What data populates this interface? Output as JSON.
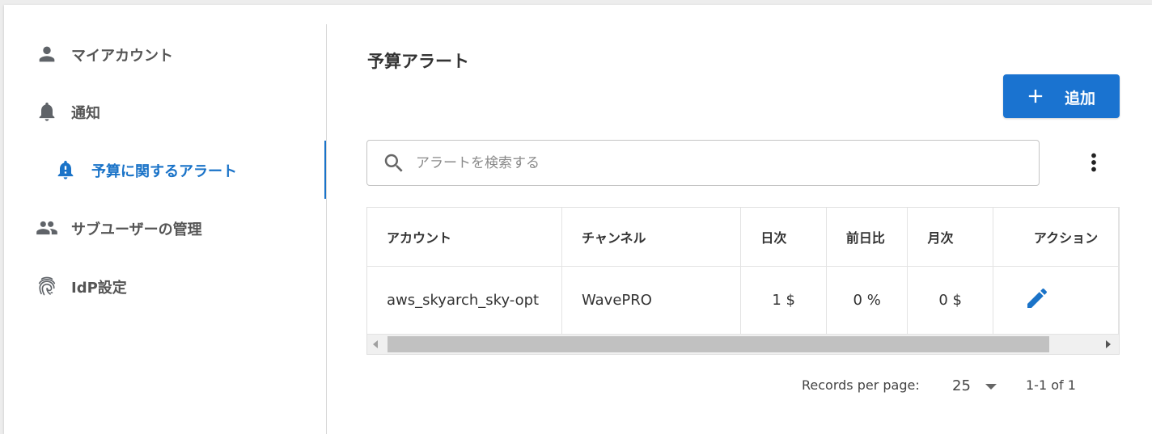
{
  "sidebar": {
    "items": [
      {
        "label": "マイアカウント",
        "icon": "person-icon"
      },
      {
        "label": "通知",
        "icon": "bell-icon"
      },
      {
        "label": "予算に関するアラート",
        "icon": "bell-alert-icon",
        "active": true
      },
      {
        "label": "サブユーザーの管理",
        "icon": "people-icon"
      },
      {
        "label": "IdP設定",
        "icon": "fingerprint-icon"
      }
    ]
  },
  "main": {
    "title": "予算アラート",
    "add_button": "追加",
    "search": {
      "placeholder": "アラートを検索する",
      "value": ""
    },
    "table": {
      "headers": [
        "アカウント",
        "チャンネル",
        "日次",
        "前日比",
        "月次",
        "アクション"
      ],
      "rows": [
        {
          "account": "aws_skyarch_sky-opt",
          "channel": "WavePRO",
          "daily": "1 $",
          "ratio": "0 %",
          "monthly": "0 $",
          "action_icon": "edit-icon"
        }
      ]
    },
    "pagination": {
      "records_label": "Records per page:",
      "per_page": "25",
      "range": "1-1 of 1"
    }
  },
  "colors": {
    "accent": "#1a73c8",
    "button": "#1a73d0",
    "icon_gray": "#5f6368"
  }
}
